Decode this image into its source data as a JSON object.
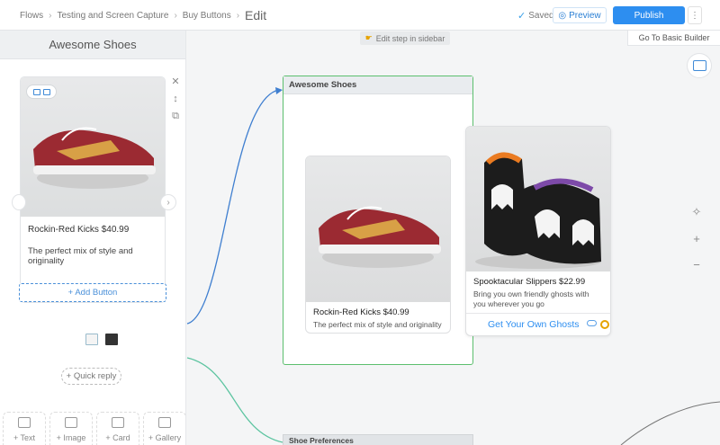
{
  "breadcrumbs": [
    "Flows",
    "Testing and Screen Capture",
    "Buy Buttons"
  ],
  "page_title": "Edit",
  "status": {
    "saved_label": "Saved"
  },
  "toolbar": {
    "preview_label": "Preview",
    "publish_label": "Publish",
    "more_label": "⋮"
  },
  "sidebar": {
    "title": "Awesome Shoes",
    "card": {
      "title": "Rockin-Red Kicks $40.99",
      "subtitle": "The perfect mix of style and originality",
      "add_button_label": "+ Add Button"
    },
    "quick_reply_label": "+ Quick reply",
    "palette": [
      {
        "label": "+ Text",
        "icon": "text-icon"
      },
      {
        "label": "+ Image",
        "icon": "image-icon"
      },
      {
        "label": "+ Card",
        "icon": "card-icon"
      },
      {
        "label": "+ Gallery",
        "icon": "gallery-icon"
      }
    ]
  },
  "canvas": {
    "hint_label": "Edit step in sidebar",
    "basic_builder_label": "Go To Basic Builder",
    "node_title": "Awesome Shoes",
    "next_node_title": "Shoe Preferences",
    "cards": [
      {
        "title": "Rockin-Red Kicks $40.99",
        "subtitle": "The perfect mix of style and originality"
      },
      {
        "title": "Spooktacular Slippers $22.99",
        "subtitle": "Bring you own friendly ghosts with you wherever you go",
        "button_label": "Get Your Own Ghosts"
      }
    ]
  },
  "colors": {
    "accent": "#2d8ef0",
    "node_border": "#5cbf6e",
    "flow_blue": "#3f7fd0",
    "flow_green": "#5cc4a0"
  }
}
